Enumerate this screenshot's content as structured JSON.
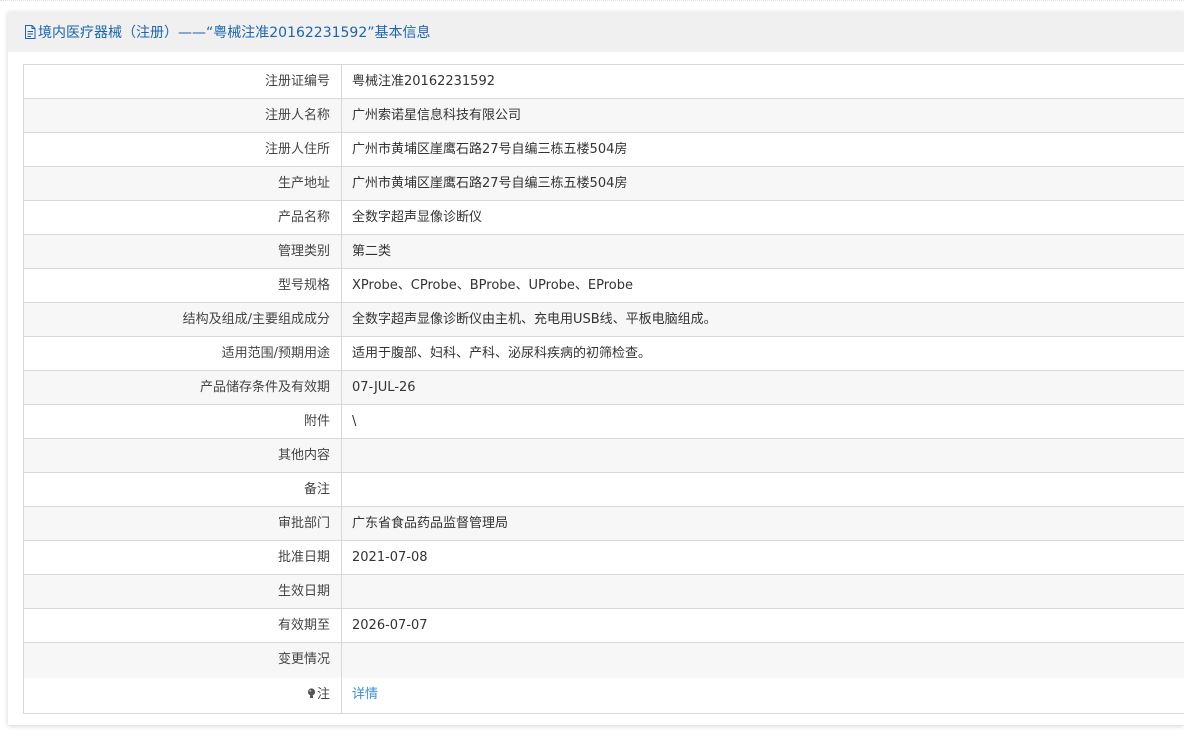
{
  "header": {
    "title": "境内医疗器械（注册）——“粤械注准20162231592”基本信息",
    "icon": "document-icon"
  },
  "rows": [
    {
      "label": "注册证编号",
      "value": "粤械注准20162231592"
    },
    {
      "label": "注册人名称",
      "value": "广州索诺星信息科技有限公司"
    },
    {
      "label": "注册人住所",
      "value": "广州市黄埔区崖鹰石路27号自编三栋五楼504房"
    },
    {
      "label": "生产地址",
      "value": "广州市黄埔区崖鹰石路27号自编三栋五楼504房"
    },
    {
      "label": "产品名称",
      "value": "全数字超声显像诊断仪"
    },
    {
      "label": "管理类别",
      "value": "第二类"
    },
    {
      "label": "型号规格",
      "value": "XProbe、CProbe、BProbe、UProbe、EProbe"
    },
    {
      "label": "结构及组成/主要组成成分",
      "value": "全数字超声显像诊断仪由主机、充电用USB线、平板电脑组成。"
    },
    {
      "label": "适用范围/预期用途",
      "value": "适用于腹部、妇科、产科、泌尿科疾病的初筛检查。"
    },
    {
      "label": "产品储存条件及有效期",
      "value": "07-JUL-26"
    },
    {
      "label": "附件",
      "value": "\\"
    },
    {
      "label": "其他内容",
      "value": ""
    },
    {
      "label": "备注",
      "value": ""
    },
    {
      "label": "审批部门",
      "value": "广东省食品药品监督管理局"
    },
    {
      "label": "批准日期",
      "value": "2021-07-08"
    },
    {
      "label": "生效日期",
      "value": ""
    },
    {
      "label": "有效期至",
      "value": "2026-07-07"
    },
    {
      "label": "变更情况",
      "value": ""
    }
  ],
  "note_row": {
    "label": "注",
    "icon": "bulb-icon",
    "link_text": "详情"
  },
  "colors": {
    "header_text": "#1a65b0",
    "link": "#3a8ed8",
    "row_alt": "#f7f7f7",
    "border": "#d8d8d8"
  }
}
